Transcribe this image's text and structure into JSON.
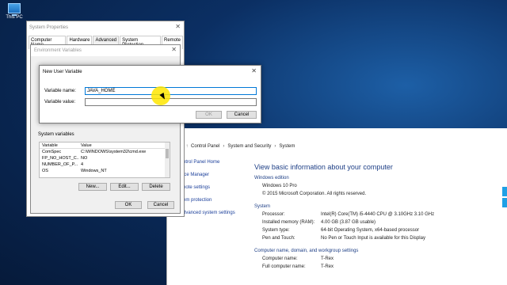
{
  "desktop": {
    "icon_label": "This PC"
  },
  "system_window": {
    "breadcrumb": [
      "Control Panel",
      "System and Security",
      "System"
    ],
    "side_links": [
      "ntrol Panel Home",
      "ice Manager",
      "note settings",
      "em protection",
      "dvanced system settings"
    ],
    "heading": "View basic information about your computer",
    "windows_edition": {
      "section": "Windows edition",
      "edition": "Windows 10 Pro",
      "copyright": "© 2015 Microsoft Corporation. All rights reserved."
    },
    "system": {
      "section": "System",
      "rows": [
        {
          "key": "Processor:",
          "value": "Intel(R) Core(TM) i5-4440 CPU @ 3.10GHz   3.10 GHz"
        },
        {
          "key": "Installed memory (RAM):",
          "value": "4.00 GB (3.87 GB usable)"
        },
        {
          "key": "System type:",
          "value": "64-bit Operating System, x64-based processor"
        },
        {
          "key": "Pen and Touch:",
          "value": "No Pen or Touch Input is available for this Display"
        }
      ]
    },
    "computer": {
      "section": "Computer name, domain, and workgroup settings",
      "rows": [
        {
          "key": "Computer name:",
          "value": "T-Rex"
        },
        {
          "key": "Full computer name:",
          "value": "T-Rex"
        }
      ]
    }
  },
  "system_properties": {
    "title": "System Properties",
    "tabs": [
      "Computer Name",
      "Hardware",
      "Advanced",
      "System Protection",
      "Remote"
    ],
    "ok": "OK",
    "cancel": "Cancel"
  },
  "env_vars": {
    "title": "Environment Variables",
    "system_vars_label": "System variables",
    "columns": [
      "Variable",
      "Value"
    ],
    "rows": [
      [
        "ComSpec",
        "C:\\WINDOWS\\system32\\cmd.exe"
      ],
      [
        "FP_NO_HOST_C...",
        "NO"
      ],
      [
        "NUMBER_OF_P...",
        "4"
      ],
      [
        "OS",
        "Windows_NT"
      ]
    ],
    "new_button": "New...",
    "edit_button": "Edit...",
    "delete_button": "Delete"
  },
  "new_user_variable": {
    "title": "New User Variable",
    "name_label": "Variable name:",
    "name_value": "JAVA_HOME",
    "value_label": "Variable value:",
    "value_value": "",
    "ok": "OK",
    "cancel": "Cancel"
  }
}
